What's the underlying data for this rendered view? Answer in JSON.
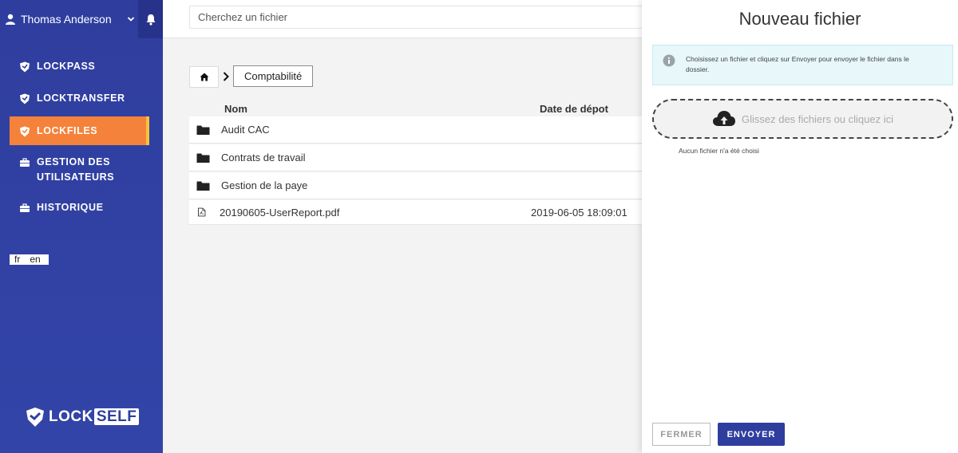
{
  "sidebar": {
    "user_name": "Thomas Anderson",
    "nav": [
      {
        "label": "LOCKPASS",
        "icon": "shield-icon"
      },
      {
        "label": "LOCKTRANSFER",
        "icon": "shield-icon"
      },
      {
        "label": "LOCKFILES",
        "icon": "shield-icon",
        "active": true
      },
      {
        "label": "GESTION DES UTILISATEURS",
        "icon": "briefcase-icon"
      },
      {
        "label": "HISTORIQUE",
        "icon": "briefcase-icon"
      }
    ],
    "lang": {
      "fr": "fr",
      "en": "en"
    },
    "logo": {
      "lock": "LOCK",
      "self": "SELF"
    },
    "colors": {
      "bg": "#2f3e9e",
      "active": "#f5823a"
    }
  },
  "search": {
    "placeholder": "Cherchez un fichier"
  },
  "breadcrumb": {
    "folder": "Comptabilité"
  },
  "table": {
    "headers": {
      "name": "Nom",
      "date": "Date de dépot"
    },
    "rows": [
      {
        "type": "folder",
        "name": "Audit CAC",
        "date": ""
      },
      {
        "type": "folder",
        "name": "Contrats de travail",
        "date": ""
      },
      {
        "type": "folder",
        "name": "Gestion de la paye",
        "date": ""
      },
      {
        "type": "pdf",
        "name": "20190605-UserReport.pdf",
        "date": "2019-06-05 18:09:01"
      }
    ]
  },
  "panel": {
    "title": "Nouveau fichier",
    "info": "Choisissez un fichier et cliquez sur Envoyer pour envoyer le fichier dans le dossier.",
    "dropzone": "Glissez des fichiers ou cliquez ici",
    "no_file": "Aucun fichier n'a été choisi",
    "cancel_label": "FERMER",
    "submit_label": "ENVOYER"
  }
}
